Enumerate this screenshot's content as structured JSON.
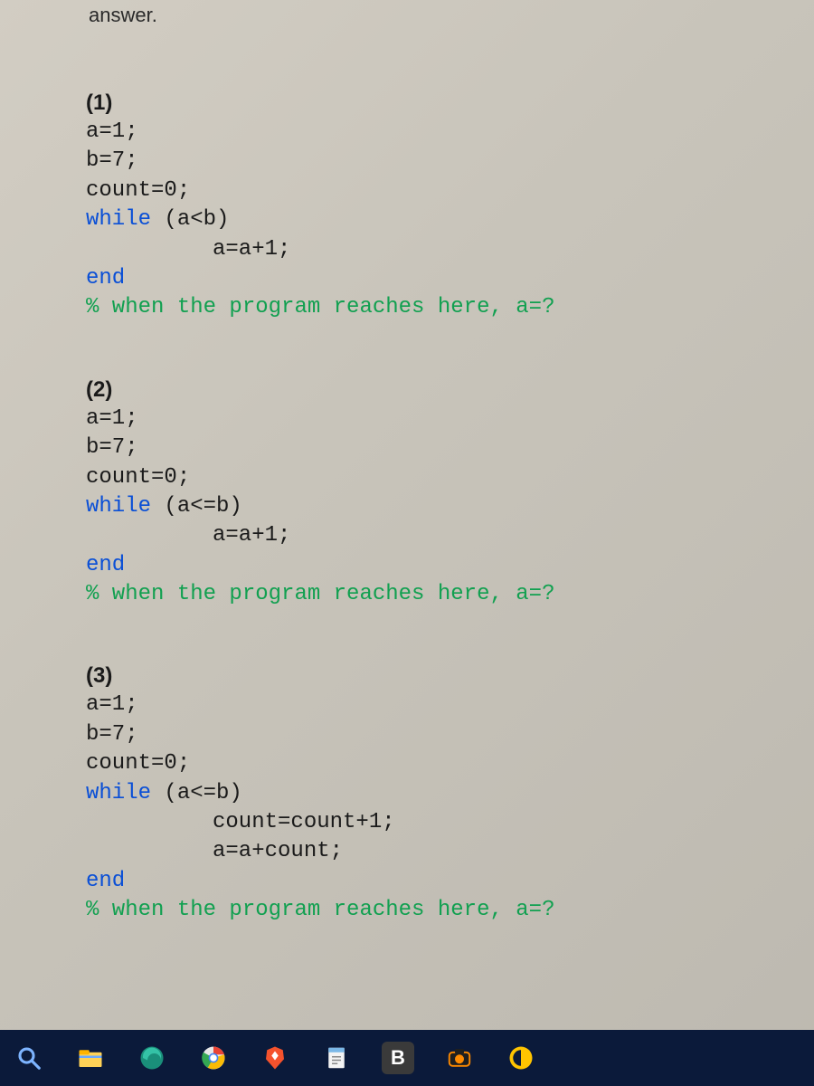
{
  "header_fragment": "answer.",
  "snippets": [
    {
      "label": "(1)",
      "lines": [
        {
          "t": "plain",
          "text": "a=1;"
        },
        {
          "t": "plain",
          "text": "b=7;"
        },
        {
          "t": "plain",
          "text": "count=0;"
        },
        {
          "t": "kwline",
          "kw": "while",
          "rest": " (a<b)"
        },
        {
          "t": "indent",
          "text": "a=a+1;"
        },
        {
          "t": "kwline",
          "kw": "end",
          "rest": ""
        },
        {
          "t": "comment",
          "text": "% when the program reaches here, a=?"
        }
      ]
    },
    {
      "label": "(2)",
      "lines": [
        {
          "t": "plain",
          "text": "a=1;"
        },
        {
          "t": "plain",
          "text": "b=7;"
        },
        {
          "t": "plain",
          "text": "count=0;"
        },
        {
          "t": "kwline",
          "kw": "while",
          "rest": " (a<=b)"
        },
        {
          "t": "indent",
          "text": "a=a+1;"
        },
        {
          "t": "kwline",
          "kw": "end",
          "rest": ""
        },
        {
          "t": "comment",
          "text": "% when the program reaches here, a=?"
        }
      ]
    },
    {
      "label": "(3)",
      "lines": [
        {
          "t": "plain",
          "text": "a=1;"
        },
        {
          "t": "plain",
          "text": "b=7;"
        },
        {
          "t": "plain",
          "text": "count=0;"
        },
        {
          "t": "kwline",
          "kw": "while",
          "rest": " (a<=b)"
        },
        {
          "t": "indent",
          "text": "count=count+1;"
        },
        {
          "t": "indent",
          "text": "a=a+count;"
        },
        {
          "t": "kwline",
          "kw": "end",
          "rest": ""
        },
        {
          "t": "comment",
          "text": "% when the program reaches here, a=?"
        }
      ]
    }
  ],
  "taskbar": {
    "icons": [
      {
        "name": "search-icon"
      },
      {
        "name": "file-explorer-icon"
      },
      {
        "name": "edge-icon"
      },
      {
        "name": "chrome-icon"
      },
      {
        "name": "brave-icon"
      },
      {
        "name": "notepad-icon"
      },
      {
        "name": "blackboard-icon",
        "letter": "B"
      },
      {
        "name": "camera-icon"
      },
      {
        "name": "app-icon"
      }
    ]
  }
}
